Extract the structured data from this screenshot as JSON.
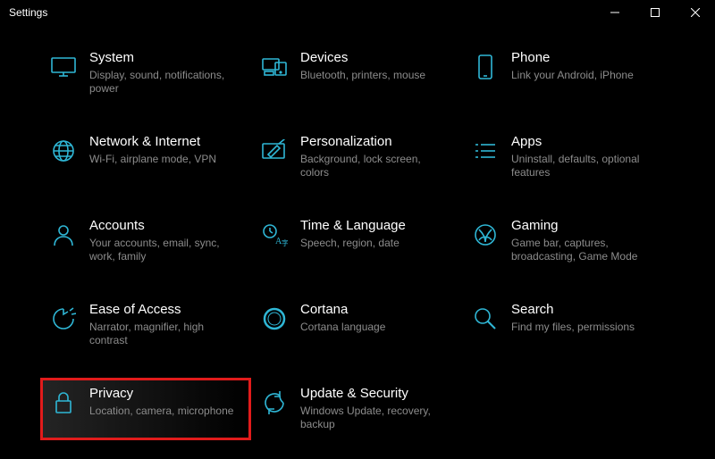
{
  "window": {
    "title": "Settings"
  },
  "tiles": [
    {
      "id": "system",
      "title": "System",
      "desc": "Display, sound, notifications, power"
    },
    {
      "id": "devices",
      "title": "Devices",
      "desc": "Bluetooth, printers, mouse"
    },
    {
      "id": "phone",
      "title": "Phone",
      "desc": "Link your Android, iPhone"
    },
    {
      "id": "network",
      "title": "Network & Internet",
      "desc": "Wi-Fi, airplane mode, VPN"
    },
    {
      "id": "personalization",
      "title": "Personalization",
      "desc": "Background, lock screen, colors"
    },
    {
      "id": "apps",
      "title": "Apps",
      "desc": "Uninstall, defaults, optional features"
    },
    {
      "id": "accounts",
      "title": "Accounts",
      "desc": "Your accounts, email, sync, work, family"
    },
    {
      "id": "time",
      "title": "Time & Language",
      "desc": "Speech, region, date"
    },
    {
      "id": "gaming",
      "title": "Gaming",
      "desc": "Game bar, captures, broadcasting, Game Mode"
    },
    {
      "id": "ease",
      "title": "Ease of Access",
      "desc": "Narrator, magnifier, high contrast"
    },
    {
      "id": "cortana",
      "title": "Cortana",
      "desc": "Cortana language"
    },
    {
      "id": "search",
      "title": "Search",
      "desc": "Find my files, permissions"
    },
    {
      "id": "privacy",
      "title": "Privacy",
      "desc": "Location, camera, microphone"
    },
    {
      "id": "update",
      "title": "Update & Security",
      "desc": "Windows Update, recovery, backup"
    }
  ],
  "highlighted": "privacy"
}
